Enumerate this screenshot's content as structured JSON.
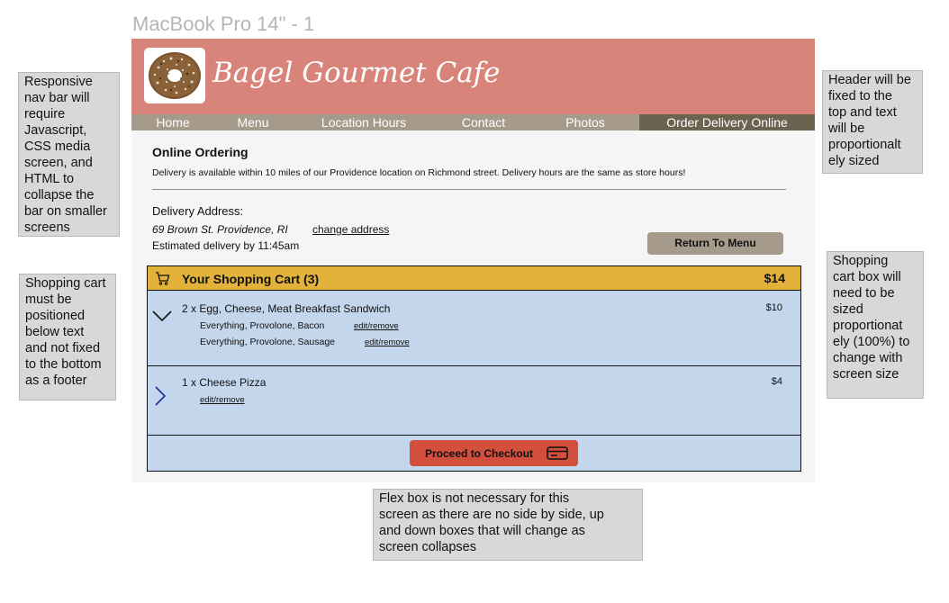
{
  "frame_title": "MacBook Pro 14\" - 1",
  "header": {
    "brand": "Bagel Gourmet Cafe",
    "logo_icon": "bagel-image",
    "bg_color": "#d9847a"
  },
  "nav": {
    "items": [
      {
        "label": "Home",
        "active": false
      },
      {
        "label": "Menu",
        "active": false
      },
      {
        "label": "Location Hours",
        "active": false
      },
      {
        "label": "Contact",
        "active": false
      },
      {
        "label": "Photos",
        "active": false
      },
      {
        "label": "Order Delivery Online",
        "active": true
      }
    ],
    "bg_color": "#a69b8a",
    "active_color": "#6b6250"
  },
  "ordering": {
    "title": "Online Ordering",
    "delivery_note": "Delivery is available within 10 miles of our Providence location on Richmond street. Delivery hours are the same as store hours!",
    "address_label": "Delivery Address:",
    "address": "69 Brown St. Providence, RI",
    "change_address": "change address",
    "estimated_delivery": "Estimated delivery by 11:45am",
    "return_button": "Return To Menu"
  },
  "cart": {
    "title": "Your Shopping Cart (3)",
    "total": "$14",
    "header_color": "#e2b23a",
    "body_color": "#c3d6eb",
    "items": [
      {
        "line": "2 x Egg, Cheese, Meat Breakfast Sandwich",
        "price": "$10",
        "expanded": true,
        "chevron_icon": "chevron-down-icon",
        "options": [
          {
            "label": "Everything, Provolone, Bacon",
            "action": "edit/remove"
          },
          {
            "label": "Everything, Provolone, Sausage",
            "action": "edit/remove"
          }
        ]
      },
      {
        "line": "1 x Cheese Pizza",
        "price": "$4",
        "expanded": false,
        "chevron_icon": "chevron-right-icon",
        "action": "edit/remove"
      }
    ],
    "checkout_button": "Proceed to Checkout",
    "checkout_icon": "credit-card-icon",
    "checkout_color": "#d24e3d"
  },
  "notes": {
    "nav": "Responsive\nnav bar will\nrequire\nJavascript,\nCSS media\nscreen, and\nHTML to\ncollapse the\nbar on smaller\nscreens",
    "cart_position": "Shopping cart\nmust be\npositioned\nbelow text\nand not fixed\nto the bottom\nas a footer",
    "header": "Header will be\nfixed to the\ntop and text\nwill be\nproportionalt\nely sized",
    "cart_size": "Shopping\ncart box will\nneed to be\nsized\nproportionat\nely (100%) to\nchange with\nscreen size",
    "flexbox": "Flex box is not necessary for this\nscreen as there are no side by side, up\nand down boxes that will change as\nscreen collapses"
  }
}
